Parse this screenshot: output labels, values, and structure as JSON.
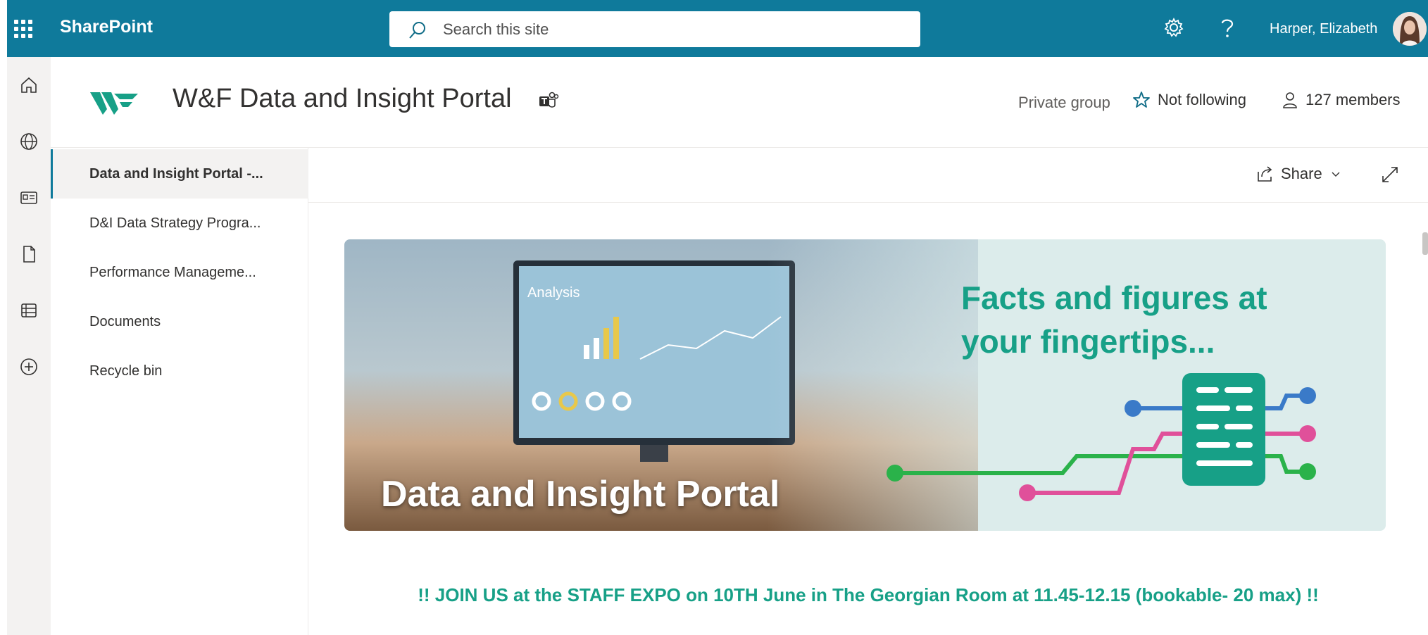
{
  "suitebar": {
    "brand": "SharePoint",
    "search_placeholder": "Search this site",
    "user_name": "Harper, Elizabeth"
  },
  "site": {
    "title": "W&F Data and Insight Portal",
    "privacy": "Private group",
    "follow_label": "Not following",
    "members_label": "127 members"
  },
  "nav": {
    "items": [
      {
        "label": "Data and Insight Portal -...",
        "active": true
      },
      {
        "label": "D&I Data Strategy Progra...",
        "active": false
      },
      {
        "label": "Performance Manageme...",
        "active": false
      },
      {
        "label": "Documents",
        "active": false
      },
      {
        "label": "Recycle bin",
        "active": false
      }
    ]
  },
  "cmdbar": {
    "share_label": "Share"
  },
  "hero": {
    "tagline": "Facts and figures at your fingertips...",
    "title": "Data and Insight Portal",
    "screen_heading": "Analysis"
  },
  "announcement": "!! JOIN US at the STAFF EXPO on 10TH June in The Georgian Room at 11.45-12.15 (bookable- 20 max) !!",
  "colors": {
    "suitebar": "#0f7a9b",
    "accent_green": "#17a087",
    "nav_active_bg": "#f3f2f1"
  }
}
